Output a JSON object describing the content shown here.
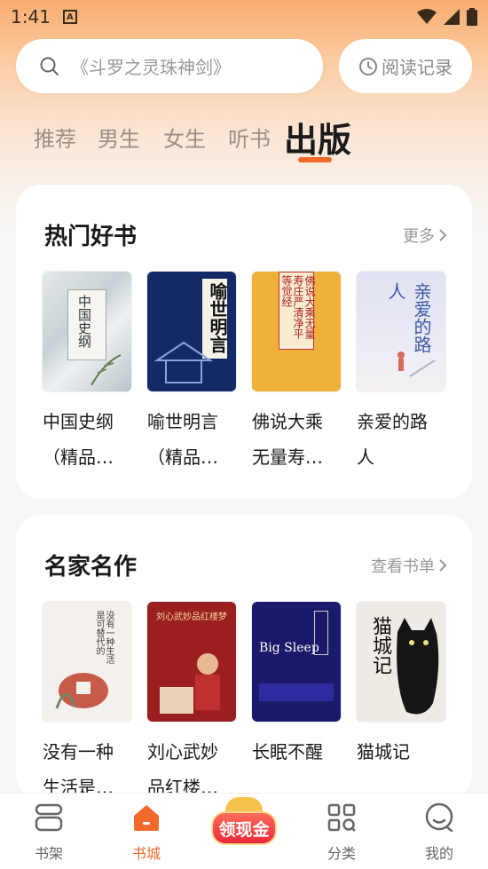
{
  "status_bar": {
    "time": "1:41",
    "notif_letter": "A"
  },
  "search": {
    "placeholder": "《斗罗之灵珠神剑》"
  },
  "history_label": "阅读记录",
  "tabs": [
    {
      "label": "推荐",
      "active": false
    },
    {
      "label": "男生",
      "active": false
    },
    {
      "label": "女生",
      "active": false
    },
    {
      "label": "听书",
      "active": false
    },
    {
      "label": "出版",
      "active": true
    }
  ],
  "sections": [
    {
      "title": "热门好书",
      "more": "更多",
      "books": [
        {
          "title": "中国史纲\n（精品…",
          "cover_text": "中国史纲"
        },
        {
          "title": "喻世明言\n（精品…",
          "cover_text": "喻世明言"
        },
        {
          "title": "佛说大乘\n无量寿…",
          "cover_text": "佛说大乘无量寿庄严清净平等觉经"
        },
        {
          "title": "亲爱的路\n人",
          "cover_text": "亲爱的路人"
        }
      ]
    },
    {
      "title": "名家名作",
      "more": "查看书单",
      "books": [
        {
          "title": "没有一种\n生活是…",
          "cover_text": "没有一种生活是可替代的"
        },
        {
          "title": "刘心武妙\n品红楼…",
          "cover_text": "刘心武妙品红楼梦"
        },
        {
          "title": "长眠不醒",
          "cover_text": "Big Sleep"
        },
        {
          "title": "猫城记",
          "cover_text": "猫城记"
        }
      ]
    }
  ],
  "tabbar": [
    {
      "label": "书架",
      "icon": "bookshelf-icon"
    },
    {
      "label": "书城",
      "icon": "home-icon",
      "active": true
    },
    {
      "label": "领现金",
      "icon": "cash-reward-icon"
    },
    {
      "label": "分类",
      "icon": "category-icon"
    },
    {
      "label": "我的",
      "icon": "profile-icon"
    }
  ],
  "colors": {
    "accent": "#f26a2b",
    "header_gradient_top": "#f9ad70"
  }
}
